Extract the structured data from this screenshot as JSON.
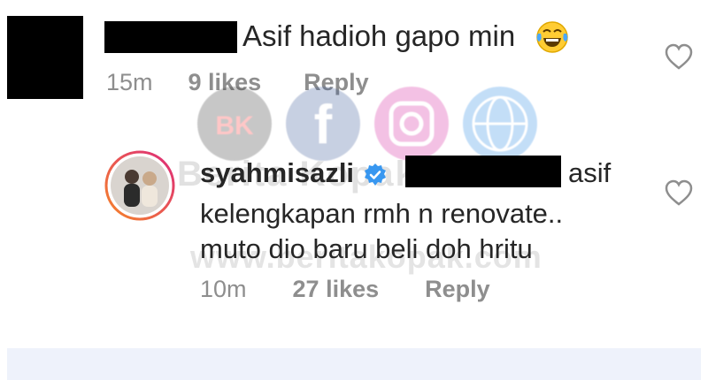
{
  "comment1": {
    "text": "Asif hadioh gapo min",
    "emoji": "laughing-tears-emoji",
    "time": "15m",
    "likes": "9 likes",
    "reply": "Reply"
  },
  "reply_comment": {
    "username": "syahmisazli",
    "text_line1": "asif",
    "text_line2": "kelengkapan rmh n renovate..",
    "text_line3": "muto dio baru beli doh hritu",
    "time": "10m",
    "likes": "27 likes",
    "reply": "Reply"
  },
  "watermark": {
    "badge": "BK",
    "text": "Berita Kopak",
    "url": "www.beritakopak.com"
  },
  "colors": {
    "text": "#262626",
    "meta": "#8e8e8e",
    "verified": "#3897f0",
    "story_ring_start": "#f58529",
    "story_ring_end": "#dd2a7b",
    "bottom_bar": "#eef2fb"
  }
}
